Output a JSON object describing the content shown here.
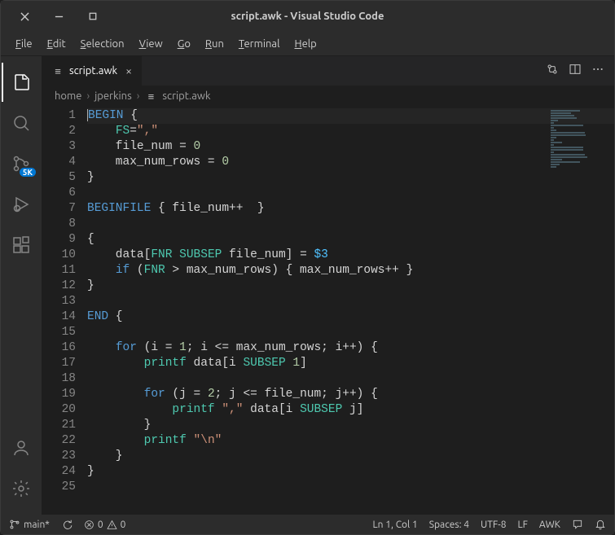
{
  "window": {
    "title": "script.awk - Visual Studio Code"
  },
  "menu": {
    "items": [
      "File",
      "Edit",
      "Selection",
      "View",
      "Go",
      "Run",
      "Terminal",
      "Help"
    ]
  },
  "activitybar": {
    "explorer": "explorer-icon",
    "search": "search-icon",
    "scm": "source-control-icon",
    "scm_badge": "5K",
    "debug": "run-debug-icon",
    "extensions": "extensions-icon",
    "account": "account-icon",
    "settings": "gear-icon"
  },
  "tab": {
    "filename": "script.awk"
  },
  "breadcrumb": {
    "parts": [
      "home",
      "jperkins",
      "script.awk"
    ]
  },
  "code": {
    "lines": [
      {
        "n": 1,
        "seg": [
          [
            "kw",
            "BEGIN"
          ],
          [
            "",
            ""
          ],
          [
            "",
            " {"
          ]
        ]
      },
      {
        "n": 2,
        "seg": [
          [
            "",
            "    "
          ],
          [
            "fn",
            "FS"
          ],
          [
            "",
            "="
          ],
          [
            "str",
            "\",\""
          ]
        ]
      },
      {
        "n": 3,
        "seg": [
          [
            "",
            "    file_num = "
          ],
          [
            "num",
            "0"
          ]
        ]
      },
      {
        "n": 4,
        "seg": [
          [
            "",
            "    max_num_rows = "
          ],
          [
            "num",
            "0"
          ]
        ]
      },
      {
        "n": 5,
        "seg": [
          [
            "",
            "}"
          ]
        ]
      },
      {
        "n": 6,
        "seg": [
          [
            "",
            ""
          ]
        ]
      },
      {
        "n": 7,
        "seg": [
          [
            "kw",
            "BEGINFILE"
          ],
          [
            "",
            " { file_num++  }"
          ]
        ]
      },
      {
        "n": 8,
        "seg": [
          [
            "",
            ""
          ]
        ]
      },
      {
        "n": 9,
        "seg": [
          [
            "",
            "{"
          ]
        ]
      },
      {
        "n": 10,
        "seg": [
          [
            "",
            "    data["
          ],
          [
            "builtin",
            "FNR"
          ],
          [
            "",
            " "
          ],
          [
            "builtin",
            "SUBSEP"
          ],
          [
            "",
            " file_num] = "
          ],
          [
            "param",
            "$3"
          ]
        ]
      },
      {
        "n": 11,
        "seg": [
          [
            "",
            "    "
          ],
          [
            "kw",
            "if"
          ],
          [
            "",
            " ("
          ],
          [
            "builtin",
            "FNR"
          ],
          [
            "",
            " > max_num_rows) { max_num_rows++ }"
          ]
        ]
      },
      {
        "n": 12,
        "seg": [
          [
            "",
            "}"
          ]
        ]
      },
      {
        "n": 13,
        "seg": [
          [
            "",
            ""
          ]
        ]
      },
      {
        "n": 14,
        "seg": [
          [
            "kw",
            "END"
          ],
          [
            "",
            " {"
          ]
        ]
      },
      {
        "n": 15,
        "seg": [
          [
            "",
            ""
          ]
        ]
      },
      {
        "n": 16,
        "seg": [
          [
            "",
            "    "
          ],
          [
            "kw",
            "for"
          ],
          [
            "",
            " (i = "
          ],
          [
            "num",
            "1"
          ],
          [
            "",
            "; i <= max_num_rows; i++) {"
          ]
        ]
      },
      {
        "n": 17,
        "seg": [
          [
            "",
            "        "
          ],
          [
            "fn",
            "printf"
          ],
          [
            "",
            " data[i "
          ],
          [
            "builtin",
            "SUBSEP"
          ],
          [
            "",
            " "
          ],
          [
            "num",
            "1"
          ],
          [
            "",
            "]"
          ]
        ]
      },
      {
        "n": 18,
        "seg": [
          [
            "",
            ""
          ]
        ]
      },
      {
        "n": 19,
        "seg": [
          [
            "",
            "        "
          ],
          [
            "kw",
            "for"
          ],
          [
            "",
            " (j = "
          ],
          [
            "num",
            "2"
          ],
          [
            "",
            "; j <= file_num; j++) {"
          ]
        ]
      },
      {
        "n": 20,
        "seg": [
          [
            "",
            "            "
          ],
          [
            "fn",
            "printf"
          ],
          [
            "",
            " "
          ],
          [
            "str",
            "\",\""
          ],
          [
            "",
            " data[i "
          ],
          [
            "builtin",
            "SUBSEP"
          ],
          [
            "",
            " j]"
          ]
        ]
      },
      {
        "n": 21,
        "seg": [
          [
            "",
            "        }"
          ]
        ]
      },
      {
        "n": 22,
        "seg": [
          [
            "",
            "        "
          ],
          [
            "fn",
            "printf"
          ],
          [
            "",
            " "
          ],
          [
            "str",
            "\"\\n\""
          ]
        ]
      },
      {
        "n": 23,
        "seg": [
          [
            "",
            "    }"
          ]
        ]
      },
      {
        "n": 24,
        "seg": [
          [
            "",
            "}"
          ]
        ]
      },
      {
        "n": 25,
        "seg": [
          [
            "",
            ""
          ]
        ]
      }
    ]
  },
  "status": {
    "branch": "main*",
    "errors": "0",
    "warnings": "0",
    "cursor": "Ln 1, Col 1",
    "spaces": "Spaces: 4",
    "encoding": "UTF-8",
    "eol": "LF",
    "language": "AWK"
  }
}
